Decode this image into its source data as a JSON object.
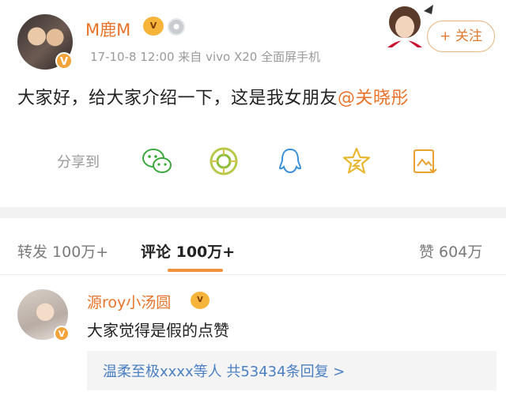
{
  "post": {
    "username": "M鹿M",
    "vip_badge": "V",
    "meta": "17-10-8 12:00 来自 vivo X20 全面屏手机",
    "follow_label": "+ 关注",
    "text_main": "大家好，给大家介绍一下，这是我女朋友",
    "mention": "@关晓彤"
  },
  "share": {
    "label": "分享到",
    "targets": [
      {
        "name": "wechat-icon"
      },
      {
        "name": "moments-icon"
      },
      {
        "name": "qq-icon"
      },
      {
        "name": "qzone-icon"
      },
      {
        "name": "save-image-icon"
      }
    ]
  },
  "tabs": {
    "repost": "转发 100万+",
    "comments": "评论 100万+",
    "likes": "赞 604万"
  },
  "comment": {
    "author": "源roy小汤圆",
    "vip_badge": "V",
    "text": "大家觉得是假的点赞",
    "replies": "温柔至极xxxx等人 共53434条回复 >"
  },
  "colors": {
    "accent": "#e8742a",
    "link": "#4a7fc2",
    "icon_green": "#3aa83a",
    "icon_blue": "#3a8fd8",
    "icon_yellow": "#e8b830"
  }
}
